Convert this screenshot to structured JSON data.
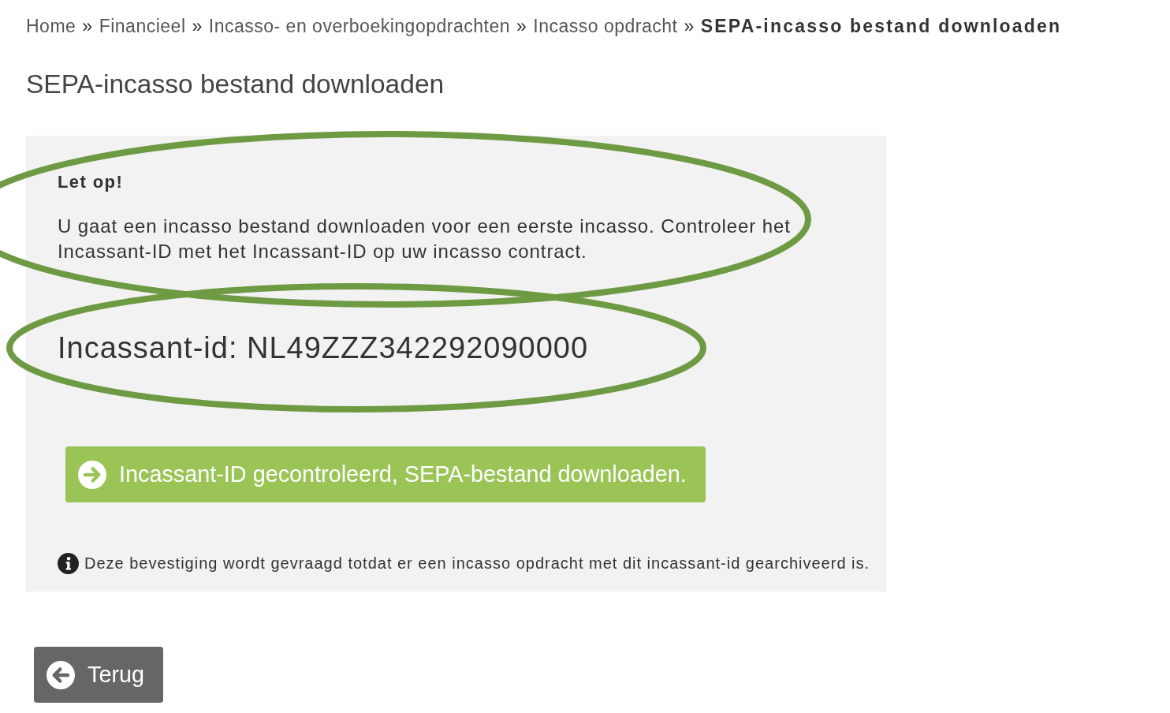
{
  "breadcrumb": {
    "items": [
      {
        "label": "Home",
        "current": false
      },
      {
        "label": "Financieel",
        "current": false
      },
      {
        "label": "Incasso- en overboekingopdrachten",
        "current": false
      },
      {
        "label": "Incasso opdracht",
        "current": false
      },
      {
        "label": "SEPA-incasso bestand downloaden",
        "current": true
      }
    ],
    "separators": [
      "»",
      "»",
      "»",
      "»"
    ]
  },
  "page_title": "SEPA-incasso bestand downloaden",
  "panel": {
    "notice": {
      "title": "Let op!",
      "text": "U gaat een incasso bestand downloaden voor een eerste incasso. Controleer het Incassant-ID met het Incassant-ID op uw incasso contract.",
      "circled": true
    },
    "creditor_id": {
      "text": "Incassant-id: NL49ZZZ342292090000",
      "circled": true
    },
    "confirm_button": {
      "label": "Incassant-ID gecontroleerd, SEPA-bestand downloaden."
    },
    "info_note": "Deze bevestiging wordt gevraagd totdat er een incasso opdracht met dit incassant-id gearchiveerd is."
  },
  "back_button": {
    "label": "Terug"
  }
}
